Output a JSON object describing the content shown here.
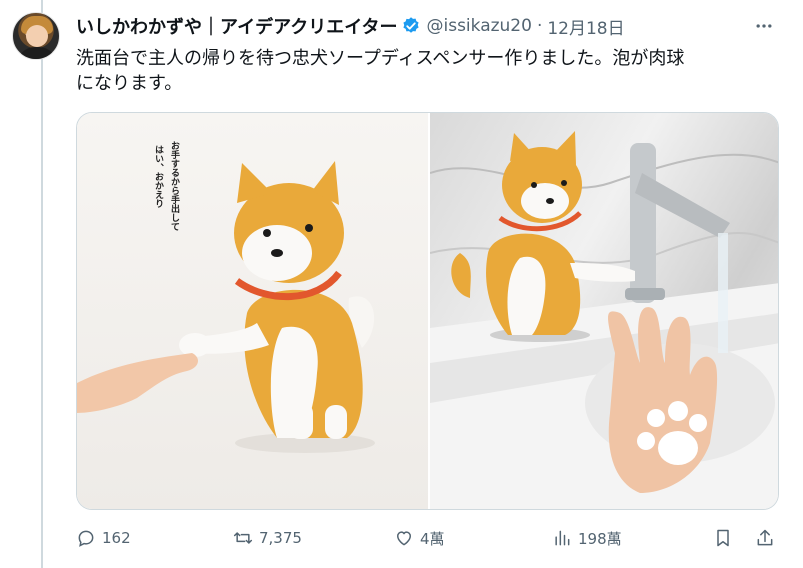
{
  "tweet": {
    "author_name": "いしかわかずや｜アイデアクリエイター",
    "handle": "@issikazu20",
    "separator": "·",
    "date": "12月18日",
    "text_line1": "洗面台で主人の帰りを待つ忠犬ソープディスペンサー作りました。泡が肉球",
    "text_line2": "になります。"
  },
  "media": {
    "caption_col1": "お手するから手出して",
    "caption_col2": "はい、おかえり"
  },
  "actions": {
    "replies": "162",
    "retweets": "7,375",
    "likes": "4萬",
    "views": "198萬"
  },
  "colors": {
    "accent": "#1d9bf0",
    "muted": "#536471",
    "shiba": "#e9a93a"
  }
}
